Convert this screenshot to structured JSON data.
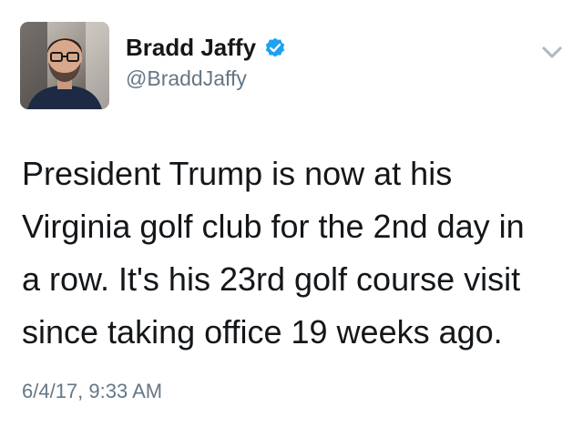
{
  "tweet": {
    "author": {
      "name": "Bradd Jaffy",
      "handle": "@BraddJaffy",
      "verified": true,
      "avatar_icon": "profile-photo"
    },
    "text_lines": [
      "President Trump is now at his",
      "Virginia golf club for the 2nd day in",
      "a row. It's his 23rd golf course visit",
      "since taking office 19 weeks ago."
    ],
    "timestamp": "6/4/17, 9:33 AM",
    "menu_icon": "chevron-down-icon"
  },
  "colors": {
    "verified_blue": "#1da1f2",
    "secondary_text": "#657786",
    "primary_text": "#14171a",
    "caret_gray": "#aab8c2"
  }
}
